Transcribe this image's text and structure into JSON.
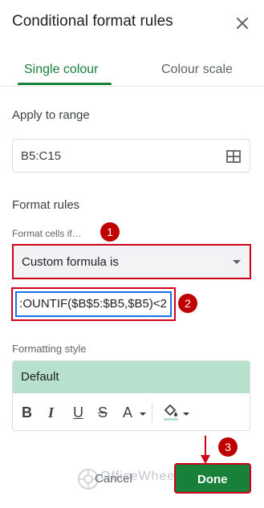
{
  "dialog": {
    "title": "Conditional format rules",
    "close_icon": "close-icon"
  },
  "tabs": [
    {
      "label": "Single colour",
      "selected": true
    },
    {
      "label": "Colour scale",
      "selected": false
    }
  ],
  "apply_range": {
    "label": "Apply to range",
    "value": "B5:C15",
    "icon": "grid-select-icon"
  },
  "format_rules": {
    "label": "Format rules",
    "condition_label": "Format cells if…",
    "condition_value": "Custom formula is",
    "formula_value": ":OUNTIF($B$5:$B5,$B5)<2"
  },
  "formatting_style": {
    "label": "Formatting style",
    "preview_text": "Default",
    "preview_color": "#b7e1cd",
    "tools": [
      "bold-icon",
      "italic-icon",
      "underline-icon",
      "strikethrough-icon",
      "text-color-icon",
      "fill-color-icon"
    ],
    "tool_glyphs": {
      "bold": "B",
      "italic": "I",
      "underline": "U",
      "strike": "S",
      "text_color": "A"
    }
  },
  "buttons": {
    "cancel": "Cancel",
    "done": "Done"
  },
  "annotations": {
    "step_1": "1",
    "step_2": "2",
    "step_3": "3",
    "highlight_color": "#d0021b",
    "badge_color": "#c00000"
  },
  "watermark": {
    "text": "OfficeWheel"
  },
  "colors": {
    "accent": "#188038",
    "focus": "#1a73e8"
  }
}
